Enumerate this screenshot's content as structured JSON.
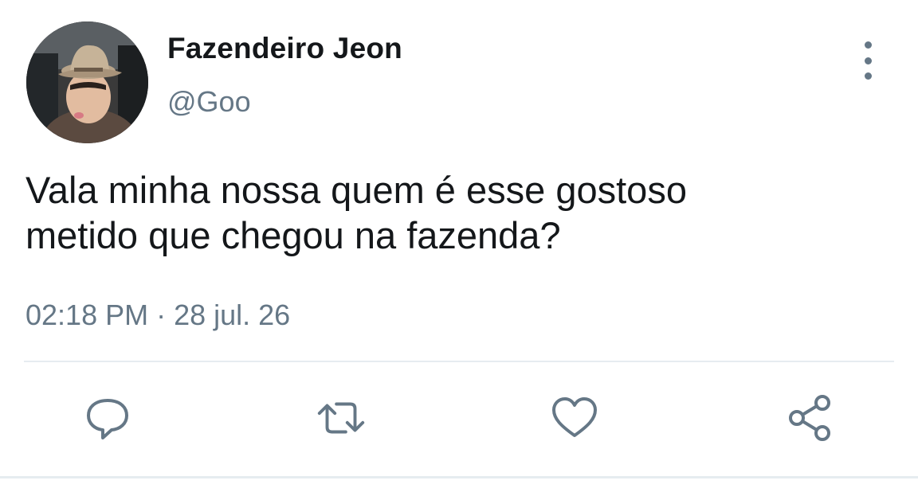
{
  "tweet": {
    "display_name": "Fazendeiro Jeon",
    "handle": "@Goo",
    "text": "Vala minha nossa quem é esse gostoso\nmetido que chegou na fazenda?",
    "timestamp": "02:18 PM · 28 jul. 26"
  },
  "icons": {
    "avatar": "avatar-photo",
    "more": "more-vertical-icon",
    "reply": "reply-icon",
    "retweet": "retweet-icon",
    "like": "heart-icon",
    "share": "share-icon"
  },
  "colors": {
    "text": "#14171a",
    "secondary": "#657786",
    "divider": "#e6ecf0",
    "background": "#ffffff"
  }
}
